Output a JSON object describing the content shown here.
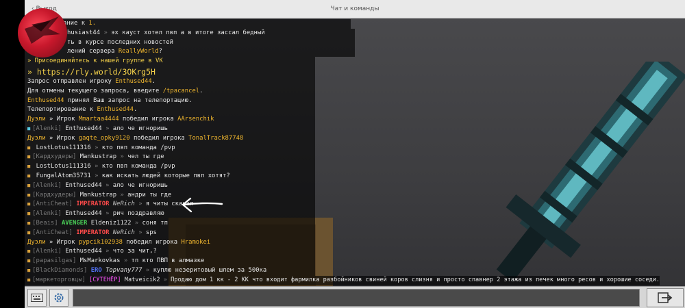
{
  "topbar": {
    "back_label": "‹ Выход",
    "title": "Чат и команды"
  },
  "chat": {
    "l1_a": "ание к ",
    "l1_b": "1.",
    "l2_name": "husiast44",
    "l2_msg": "эх кауст хотел пвп а в итоге зассал бедный",
    "l3": "ть в курсе последних новостей",
    "l4_a": "лений сервера ",
    "l4_b": "ReallyWorld",
    "l4_c": "?",
    "l5_a": "» Присоединяйтесь к нашей группе в ",
    "l5_b": "VK",
    "l6": "» https://rly.world/3OKrg5H",
    "l7_a": "Запрос отправлен игроку ",
    "l7_b": "Enthused44",
    "l7_c": ".",
    "l8_a": "Для отмены текущего запроса, введите ",
    "l8_b": "/tpacancel",
    "l8_c": ".",
    "l9_a": "Enthused44",
    "l9_b": " принял Ваш запрос на телепортацию.",
    "l10_a": "Телепортирование к ",
    "l10_b": "Enthused44",
    "l10_c": ".",
    "l11_a": "Дуэли",
    "l11_b": " » Игрок ",
    "l11_c": "Mmartaa4444",
    "l11_d": " победил игрока ",
    "l11_e": "AArsenchik",
    "l12_tag": "[Alenki]",
    "l12_name": "Enthused44",
    "l12_msg": "ало че игноришь",
    "l13_a": "Дуэли",
    "l13_b": " » Игрок ",
    "l13_c": "gaqte_opky9120",
    "l13_d": " победил игрока ",
    "l13_e": "TonalTrack87748",
    "l14_name": "LostLotus111316",
    "l14_msg": "кто пвп команда /pvp",
    "l15_tag": "[Кардхудеры]",
    "l15_name": "Mankustrap",
    "l15_msg": "чел ты где",
    "l16_name": "LostLotus111316",
    "l16_msg": "кто пвп команда /pvp",
    "l17_name": "FungalAtom35731",
    "l17_msg": "как искать людей которые пвп хотят?",
    "l18_tag": "[Alenki]",
    "l18_name": "Enthused44",
    "l18_msg": "ало че игноришь",
    "l19_tag": "[Кардхудеры]",
    "l19_name": "Mankustrap",
    "l19_msg": "андри ты где",
    "l20_tag": "[AntiCheat]",
    "l20_rank": "IMPERATOR",
    "l20_name": "NeRich",
    "l20_msg": "я читы скачал",
    "l21_tag": "[Alenki]",
    "l21_name": "Enthused44",
    "l21_msg": "рич поздравляю",
    "l22_tag": "[Beais]",
    "l22_rank": "AVENGER",
    "l22_name": "Eldeniz1122",
    "l22_msg": "соня тп",
    "l23_tag": "[AntiCheat]",
    "l23_rank": "IMPERATOR",
    "l23_name": "NeRich",
    "l23_msg": "sps",
    "l24_a": "Дуэли",
    "l24_b": " » Игрок ",
    "l24_c": "pypcik102938",
    "l24_d": " победил игрока ",
    "l24_e": "Hramokei",
    "l25_tag": "[Alenki]",
    "l25_name": "Enthused44",
    "l25_msg": "что за чит,?",
    "l26_tag": "[papasilgas]",
    "l26_name": "MsMarkovkas",
    "l26_msg": "тп кто ПВП в алмазке",
    "l27_tag": "[BlackDiamonds]",
    "l27_rank": "ERO",
    "l27_name": "Topvany777",
    "l27_msg": "куплю незеритовый шлем за 500ка",
    "l28_tag": "[маркеторговцы]",
    "l28_rank": "[СУТЕНЁР]",
    "l28_name": "Matveicik2",
    "l28_msg": "Продаю дом 1 кк - 2 КК что входит фармилка разбойников свиней коров слизня и просто спавнер 2 этажа из печек много ресов и хорошие соседи."
  },
  "separator": "»",
  "input": {
    "value": ""
  },
  "icons": {
    "keyboard": "keyboard-icon",
    "settings": "settings-icon",
    "send": "send-icon",
    "avatar": "avatar-icon"
  }
}
